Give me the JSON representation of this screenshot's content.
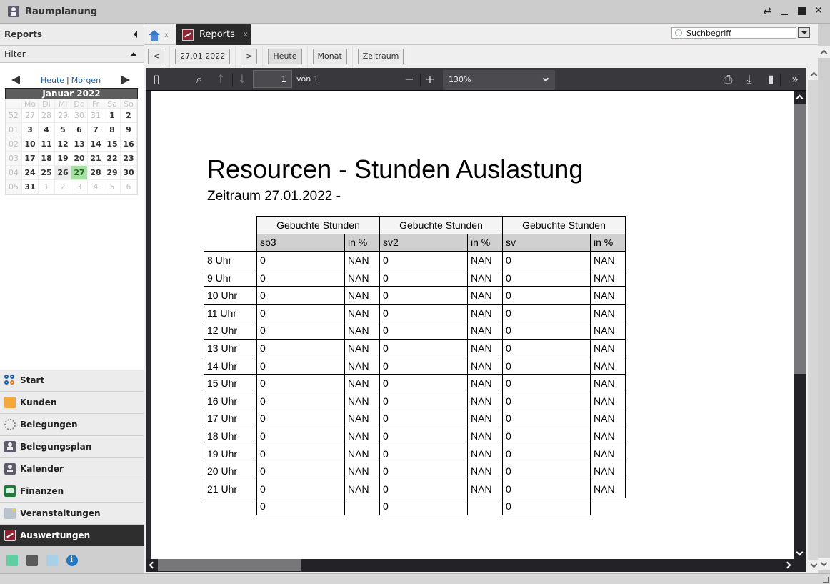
{
  "app": {
    "title": "Raumplanung"
  },
  "window_controls": [
    "restore-swap",
    "minimize",
    "maximize",
    "close"
  ],
  "sidebar": {
    "header": "Reports",
    "filter_label": "Filter",
    "calendar": {
      "links": {
        "today": "Heute",
        "separator": "|",
        "tomorrow": "Morgen"
      },
      "month_label": "Januar 2022",
      "weekdays": [
        "Mo",
        "Di",
        "Mi",
        "Do",
        "Fr",
        "Sa",
        "So"
      ],
      "weeks": [
        {
          "week": "52",
          "days": [
            {
              "d": "27",
              "other": true
            },
            {
              "d": "28",
              "other": true
            },
            {
              "d": "29",
              "other": true
            },
            {
              "d": "30",
              "other": true
            },
            {
              "d": "31",
              "other": true
            },
            {
              "d": "1"
            },
            {
              "d": "2"
            }
          ]
        },
        {
          "week": "01",
          "days": [
            {
              "d": "3"
            },
            {
              "d": "4"
            },
            {
              "d": "5"
            },
            {
              "d": "6"
            },
            {
              "d": "7"
            },
            {
              "d": "8"
            },
            {
              "d": "9"
            }
          ]
        },
        {
          "week": "02",
          "days": [
            {
              "d": "10"
            },
            {
              "d": "11"
            },
            {
              "d": "12"
            },
            {
              "d": "13"
            },
            {
              "d": "14"
            },
            {
              "d": "15"
            },
            {
              "d": "16"
            }
          ]
        },
        {
          "week": "03",
          "days": [
            {
              "d": "17"
            },
            {
              "d": "18"
            },
            {
              "d": "19"
            },
            {
              "d": "20"
            },
            {
              "d": "21"
            },
            {
              "d": "22"
            },
            {
              "d": "23"
            }
          ]
        },
        {
          "week": "04",
          "days": [
            {
              "d": "24"
            },
            {
              "d": "25"
            },
            {
              "d": "26",
              "hover": true
            },
            {
              "d": "27",
              "today": true
            },
            {
              "d": "28"
            },
            {
              "d": "29"
            },
            {
              "d": "30"
            }
          ]
        },
        {
          "week": "05",
          "days": [
            {
              "d": "31"
            },
            {
              "d": "1",
              "other": true
            },
            {
              "d": "2",
              "other": true
            },
            {
              "d": "3",
              "other": true
            },
            {
              "d": "4",
              "other": true
            },
            {
              "d": "5",
              "other": true
            },
            {
              "d": "6",
              "other": true
            }
          ]
        }
      ],
      "today_color": "#a7e0a3"
    },
    "nav": [
      {
        "label": "Start",
        "icon": "start-icon"
      },
      {
        "label": "Kunden",
        "icon": "customers-icon"
      },
      {
        "label": "Belegungen",
        "icon": "bookings-icon"
      },
      {
        "label": "Belegungsplan",
        "icon": "chair-icon"
      },
      {
        "label": "Kalender",
        "icon": "chair-icon"
      },
      {
        "label": "Finanzen",
        "icon": "money-icon"
      },
      {
        "label": "Veranstaltungen",
        "icon": "events-icon"
      },
      {
        "label": "Auswertungen",
        "icon": "chart-icon",
        "active": true
      }
    ],
    "footer_icons": [
      "calendar-settings-icon",
      "folder-import-icon",
      "tools-icon",
      "info-icon"
    ]
  },
  "tabs": [
    {
      "label": "",
      "icon": "home-icon",
      "close": "x"
    },
    {
      "label": "Reports",
      "icon": "reports-icon",
      "close": "x",
      "active": true
    }
  ],
  "search": {
    "placeholder": "Suchbegriff",
    "value": "Suchbegriff"
  },
  "toolbar": {
    "prev": "<",
    "date": "27.01.2022",
    "next": ">",
    "today": "Heute",
    "month": "Monat",
    "period": "Zeitraum"
  },
  "pdf_viewer": {
    "page": "1",
    "page_of": "von 1",
    "zoom": "130%"
  },
  "report": {
    "title": "Resourcen - Stunden Auslastung",
    "subtitle": "Zeitraum 27.01.2022 -",
    "group_header": "Gebuchte Stunden",
    "resources": [
      {
        "name": "sb3",
        "pct_label": "in %"
      },
      {
        "name": "sv2",
        "pct_label": "in %"
      },
      {
        "name": "sv",
        "pct_label": "in %"
      }
    ],
    "rows": [
      {
        "hour": "8 Uhr",
        "cells": [
          "0",
          "NAN",
          "0",
          "NAN",
          "0",
          "NAN"
        ]
      },
      {
        "hour": "9 Uhr",
        "cells": [
          "0",
          "NAN",
          "0",
          "NAN",
          "0",
          "NAN"
        ]
      },
      {
        "hour": "10 Uhr",
        "cells": [
          "0",
          "NAN",
          "0",
          "NAN",
          "0",
          "NAN"
        ]
      },
      {
        "hour": "11 Uhr",
        "cells": [
          "0",
          "NAN",
          "0",
          "NAN",
          "0",
          "NAN"
        ]
      },
      {
        "hour": "12 Uhr",
        "cells": [
          "0",
          "NAN",
          "0",
          "NAN",
          "0",
          "NAN"
        ]
      },
      {
        "hour": "13 Uhr",
        "cells": [
          "0",
          "NAN",
          "0",
          "NAN",
          "0",
          "NAN"
        ]
      },
      {
        "hour": "14 Uhr",
        "cells": [
          "0",
          "NAN",
          "0",
          "NAN",
          "0",
          "NAN"
        ]
      },
      {
        "hour": "15 Uhr",
        "cells": [
          "0",
          "NAN",
          "0",
          "NAN",
          "0",
          "NAN"
        ]
      },
      {
        "hour": "16 Uhr",
        "cells": [
          "0",
          "NAN",
          "0",
          "NAN",
          "0",
          "NAN"
        ]
      },
      {
        "hour": "17 Uhr",
        "cells": [
          "0",
          "NAN",
          "0",
          "NAN",
          "0",
          "NAN"
        ]
      },
      {
        "hour": "18 Uhr",
        "cells": [
          "0",
          "NAN",
          "0",
          "NAN",
          "0",
          "NAN"
        ]
      },
      {
        "hour": "19 Uhr",
        "cells": [
          "0",
          "NAN",
          "0",
          "NAN",
          "0",
          "NAN"
        ]
      },
      {
        "hour": "20 Uhr",
        "cells": [
          "0",
          "NAN",
          "0",
          "NAN",
          "0",
          "NAN"
        ]
      },
      {
        "hour": "21 Uhr",
        "cells": [
          "0",
          "NAN",
          "0",
          "NAN",
          "0",
          "NAN"
        ]
      }
    ],
    "totals": [
      "0",
      "0",
      "0"
    ]
  },
  "colors": {
    "active_nav_bg": "#2e2e2e",
    "pdf_toolbar_bg": "#38383d",
    "link_blue": "#1a62b0",
    "report_accent": "#8c2433"
  }
}
